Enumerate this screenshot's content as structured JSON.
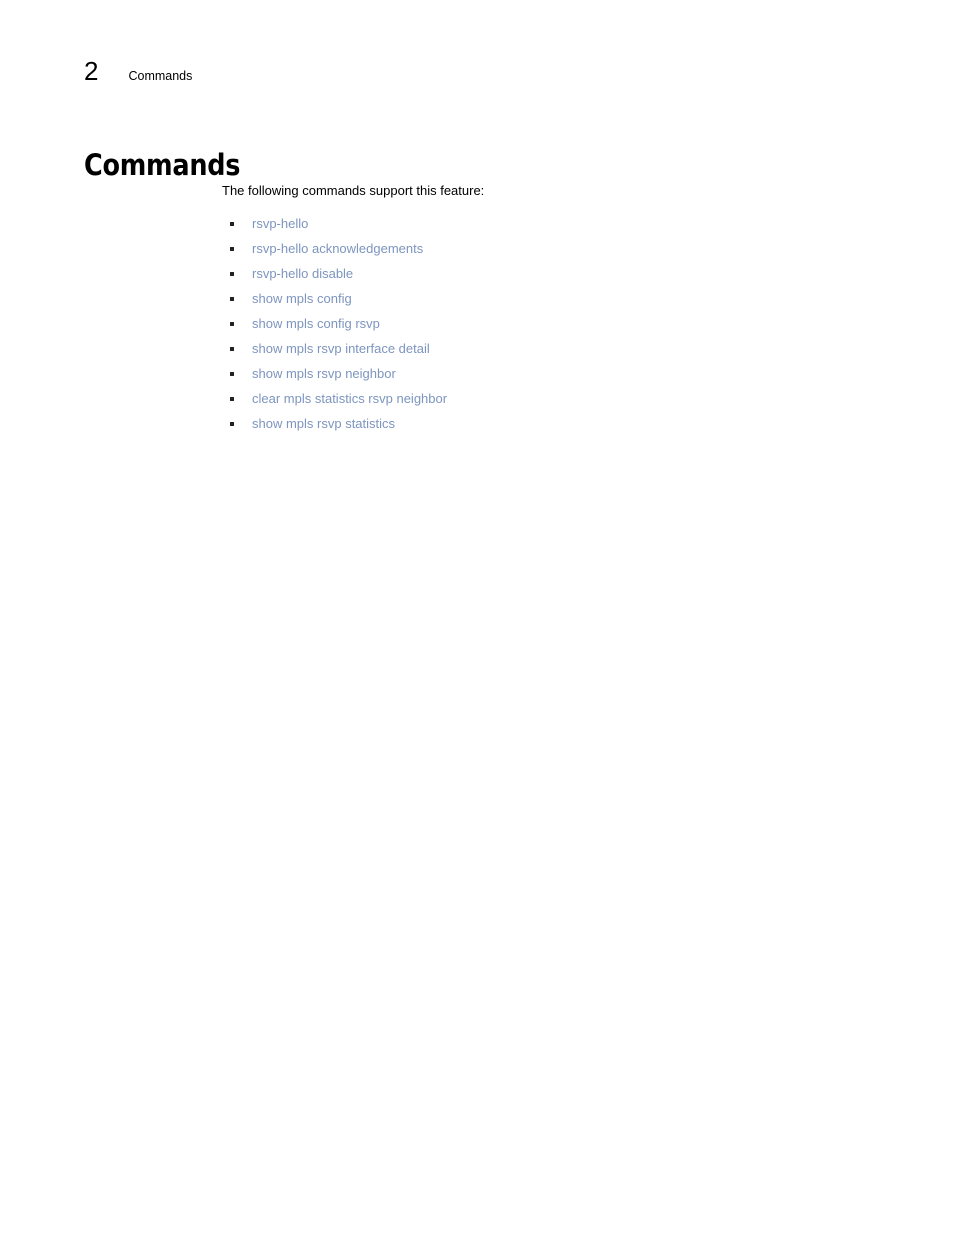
{
  "document": {
    "running_header": {
      "chapter_number": "2",
      "chapter_title": "Commands"
    },
    "page_title": "Commands",
    "intro_text": "The following commands support this feature:",
    "link_color": "#7d95bf",
    "body_text_color": "#000000",
    "bullet_color": "#231f20",
    "background_color": "#ffffff",
    "command_list": [
      {
        "label": "rsvp-hello"
      },
      {
        "label": "rsvp-hello acknowledgements"
      },
      {
        "label": "rsvp-hello disable"
      },
      {
        "label": "show mpls config"
      },
      {
        "label": "show mpls config rsvp"
      },
      {
        "label": "show mpls rsvp interface detail"
      },
      {
        "label": "show mpls rsvp neighbor"
      },
      {
        "label": "clear mpls statistics rsvp neighbor"
      },
      {
        "label": "show mpls rsvp statistics"
      }
    ]
  }
}
